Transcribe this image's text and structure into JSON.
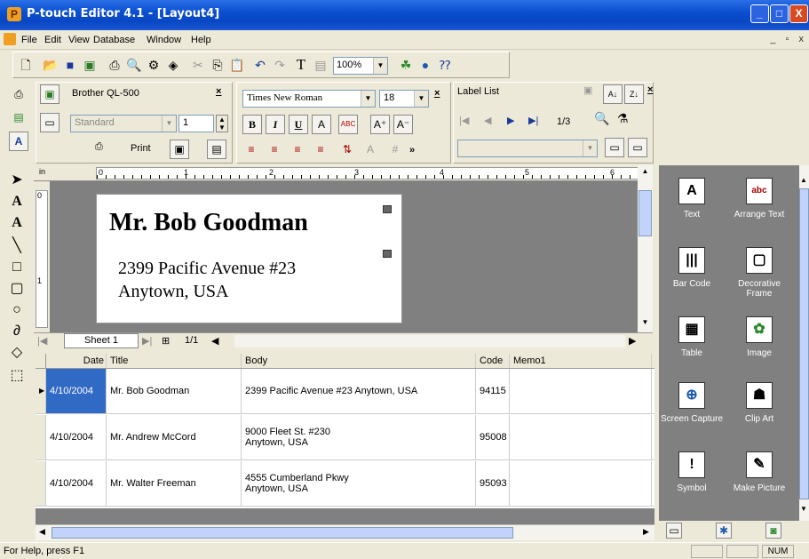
{
  "window": {
    "title": "P-touch Editor 4.1 - [Layout4]",
    "min": "_",
    "max": "□",
    "close": "X"
  },
  "menu": [
    "File",
    "Edit",
    "View",
    "Database",
    "Window",
    "Help"
  ],
  "mdi": {
    "min": "_",
    "restore": "▫",
    "close": "x"
  },
  "toolbar": {
    "zoom": "100%"
  },
  "printer_panel": {
    "printer": "Brother QL-500",
    "print_label": "Print",
    "format": "Standard",
    "copies": "1"
  },
  "font_panel": {
    "font": "Times New Roman",
    "size": "18",
    "bold": "B",
    "italic": "I",
    "underline": "U"
  },
  "label_list": {
    "title": "Label List",
    "page": "1/3"
  },
  "ruler": {
    "unit": "in",
    "ticks": [
      "0",
      "1",
      "2",
      "3",
      "4",
      "5",
      "6"
    ],
    "vticks": [
      "0",
      "1"
    ]
  },
  "label": {
    "name": "Mr. Bob Goodman",
    "address_line1": "2399 Pacific Avenue #23",
    "address_line2": "Anytown, USA"
  },
  "sheet": {
    "tab": "Sheet 1",
    "page": "1/1"
  },
  "grid": {
    "columns": [
      "Date",
      "Title",
      "Body",
      "Code",
      "Memo1"
    ],
    "rows": [
      {
        "date": "4/10/2004",
        "title": "Mr. Bob Goodman",
        "body1": "2399 Pacific Avenue #23 Anytown, USA",
        "body2": "",
        "code": "94115",
        "memo": ""
      },
      {
        "date": "4/10/2004",
        "title": "Mr. Andrew McCord",
        "body1": "9000 Fleet St. #230",
        "body2": "Anytown, USA",
        "code": "95008",
        "memo": ""
      },
      {
        "date": "4/10/2004",
        "title": "Mr. Walter Freeman",
        "body1": "4555 Cumberland Pkwy",
        "body2": "Anytown, USA",
        "code": "95093",
        "memo": ""
      }
    ]
  },
  "palette": [
    {
      "label": "Text",
      "icon": "A"
    },
    {
      "label": "Arrange Text",
      "icon": "abc"
    },
    {
      "label": "Bar Code",
      "icon": "|||"
    },
    {
      "label": "Decorative Frame",
      "icon": "▢"
    },
    {
      "label": "Table",
      "icon": "▦"
    },
    {
      "label": "Image",
      "icon": "✿"
    },
    {
      "label": "Screen Capture",
      "icon": "⊕"
    },
    {
      "label": "Clip Art",
      "icon": "☗"
    },
    {
      "label": "Symbol",
      "icon": "!"
    },
    {
      "label": "Make Picture",
      "icon": "✎"
    }
  ],
  "status": {
    "help": "For Help, press F1",
    "num": "NUM"
  },
  "colors": {
    "title_bar": "#0a4fd0",
    "canvas_bg": "#808080",
    "selected_cell": "#316ac5"
  }
}
